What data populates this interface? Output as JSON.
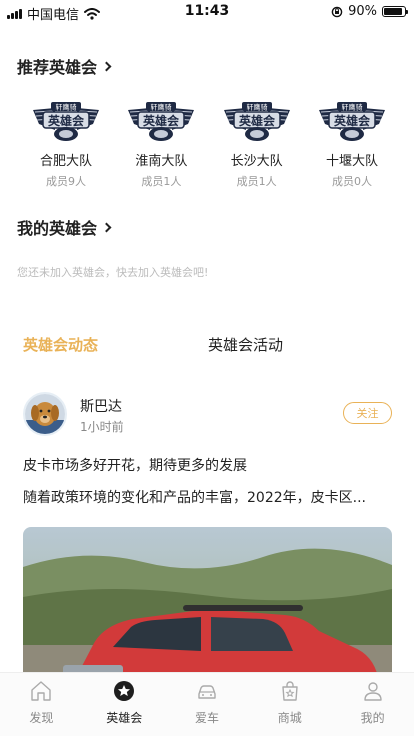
{
  "status_bar": {
    "carrier": "中国电信",
    "time": "11:43",
    "battery": "90%",
    "battery_level": 0.9
  },
  "recommended": {
    "title": "推荐英雄会",
    "badge_top_text": "轩鹰骑",
    "badge_main_text": "英雄会",
    "teams": [
      {
        "name": "合肥大队",
        "members": "成员9人"
      },
      {
        "name": "淮南大队",
        "members": "成员1人"
      },
      {
        "name": "长沙大队",
        "members": "成员1人"
      },
      {
        "name": "十堰大队",
        "members": "成员0人"
      }
    ]
  },
  "my_clubs": {
    "title": "我的英雄会",
    "empty_tip": "您还未加入英雄会，快去加入英雄会吧!"
  },
  "tabs": {
    "active": "英雄会动态",
    "inactive": "英雄会活动"
  },
  "post": {
    "author": "斯巴达",
    "time": "1小时前",
    "follow_label": "关注",
    "title": "皮卡市场多好开花，期待更多的发展",
    "excerpt": "随着政策环境的变化和产品的丰富，2022年，皮卡区..."
  },
  "tabbar": {
    "items": [
      {
        "label": "发现",
        "icon": "home-icon"
      },
      {
        "label": "英雄会",
        "icon": "star-badge-icon"
      },
      {
        "label": "爱车",
        "icon": "car-icon"
      },
      {
        "label": "商城",
        "icon": "mall-icon"
      },
      {
        "label": "我的",
        "icon": "person-icon"
      }
    ]
  },
  "colors": {
    "accent": "#e9b257",
    "text": "#222222",
    "muted": "#999999"
  }
}
